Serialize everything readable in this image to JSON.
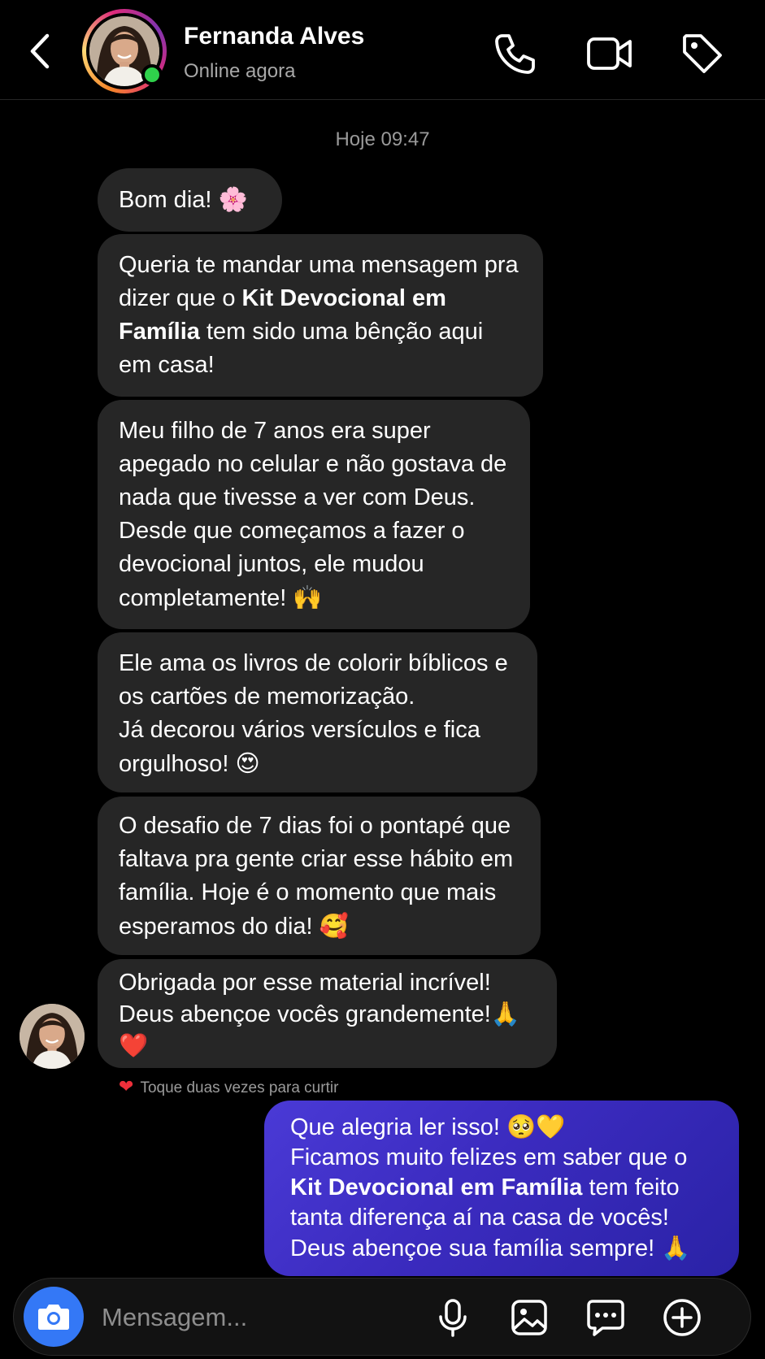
{
  "header": {
    "contact_name": "Fernanda Alves",
    "status": "Online agora",
    "icons": [
      "back-icon",
      "phone-icon",
      "video-icon",
      "tag-icon"
    ]
  },
  "conversation": {
    "timestamp": "Hoje 09:47",
    "incoming": {
      "m1": {
        "text": "Bom dia!",
        "emoji": "🌸"
      },
      "m2": {
        "pre": "Queria te mandar uma mensagem pra dizer que o ",
        "bold": "Kit Devocional em Família",
        "post": " tem sido uma bênção aqui em casa!"
      },
      "m3": {
        "text": "Meu filho de 7 anos era super apegado no celular e não gostava de nada que tivesse a ver com Deus. Desde que começamos a fazer o devocional juntos, ele mudou completamente!",
        "emoji": "🙌"
      },
      "m4": {
        "line1": "Ele ama os livros de colorir bíblicos e os cartões de memorização.",
        "line2": "Já decorou vários versículos e fica orgulhoso!",
        "emoji": "😍"
      },
      "m5": {
        "text": "O desafio de 7 dias foi o pontapé que faltava pra gente criar esse hábito em família. Hoje é o momento que mais esperamos do dia!",
        "emoji": "🥰"
      },
      "m6": {
        "line1": "Obrigada por esse material incrível!",
        "line2": "Deus abençoe vocês grandemente!",
        "emoji1": "🙏",
        "emoji2": "❤️"
      }
    },
    "like_hint": {
      "heart": "❤",
      "text": "Toque duas vezes para curtir"
    },
    "outgoing": {
      "line1": "Que alegria ler isso!",
      "line1_emoji": "🥺💛",
      "line2": "Ficamos muito felizes em saber que o",
      "bold": "Kit Devocional em Família",
      "line3_post": " tem feito",
      "line4": "tanta diferença aí na casa de vocês!",
      "line5": "Deus abençoe sua família sempre!",
      "line5_emoji": "🙏"
    }
  },
  "composer": {
    "placeholder": "Mensagem...",
    "icons": [
      "camera-icon",
      "microphone-icon",
      "gallery-icon",
      "sticker-icon",
      "add-icon"
    ]
  },
  "colors": {
    "background": "#000000",
    "incoming_bubble": "#262626",
    "outgoing_bubble": "#3b2bbf",
    "online": "#2fd14b",
    "camera_button": "#3478f6",
    "like_heart": "#ed2f3a"
  }
}
